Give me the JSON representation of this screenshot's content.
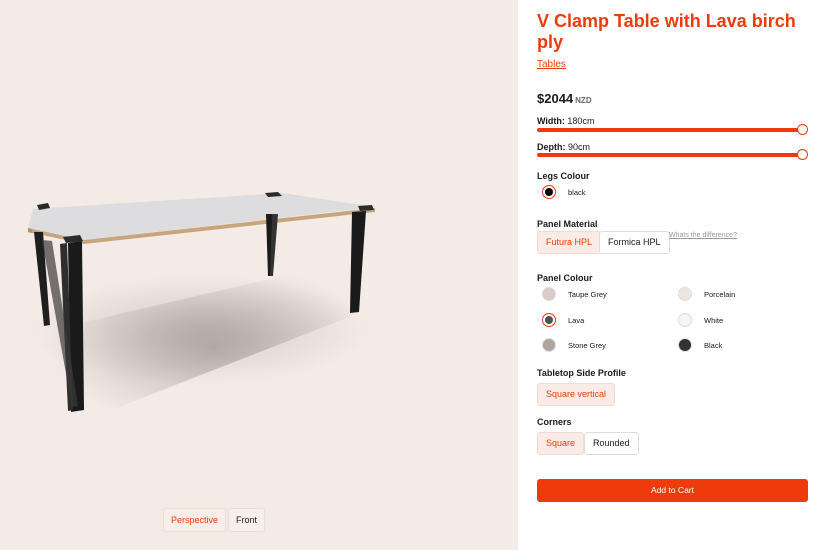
{
  "product": {
    "title": "V Clamp Table with Lava birch ply",
    "category": "Tables",
    "price": "$2044",
    "currency": "NZD"
  },
  "width": {
    "label": "Width:",
    "value": "180cm",
    "fraction": 1.0
  },
  "depth": {
    "label": "Depth:",
    "value": "90cm",
    "fraction": 1.0
  },
  "legs_colour": {
    "title": "Legs Colour",
    "options": [
      {
        "label": "black",
        "color": "#000000",
        "selected": true
      }
    ]
  },
  "panel_material": {
    "title": "Panel Material",
    "options": [
      {
        "label": "Futura HPL",
        "selected": true
      },
      {
        "label": "Formica HPL",
        "selected": false
      }
    ],
    "help_link": "Whats the difference?"
  },
  "panel_colour": {
    "title": "Panel Colour",
    "options": [
      {
        "label": "Taupe Grey",
        "color": "#d8cdc8",
        "selected": false
      },
      {
        "label": "Porcelain",
        "color": "#ede5e0",
        "selected": false
      },
      {
        "label": "Lava",
        "color": "#4c5154",
        "selected": true
      },
      {
        "label": "White",
        "color": "#f7f5f3",
        "selected": false
      },
      {
        "label": "Stone Grey",
        "color": "#b0a49f",
        "selected": false
      },
      {
        "label": "Black",
        "color": "#333333",
        "selected": false
      }
    ]
  },
  "tabletop_profile": {
    "title": "Tabletop Side Profile",
    "options": [
      {
        "label": "Square vertical",
        "selected": true
      }
    ]
  },
  "corners": {
    "title": "Corners",
    "options": [
      {
        "label": "Square",
        "selected": true
      },
      {
        "label": "Rounded",
        "selected": false
      }
    ]
  },
  "add_to_cart": "Add to Cart",
  "viewer": {
    "views": [
      {
        "label": "Perspective",
        "selected": true
      },
      {
        "label": "Front",
        "selected": false
      }
    ]
  },
  "colors": {
    "accent": "#ef3b0b",
    "viewer_bg": "#f4ebe7"
  }
}
